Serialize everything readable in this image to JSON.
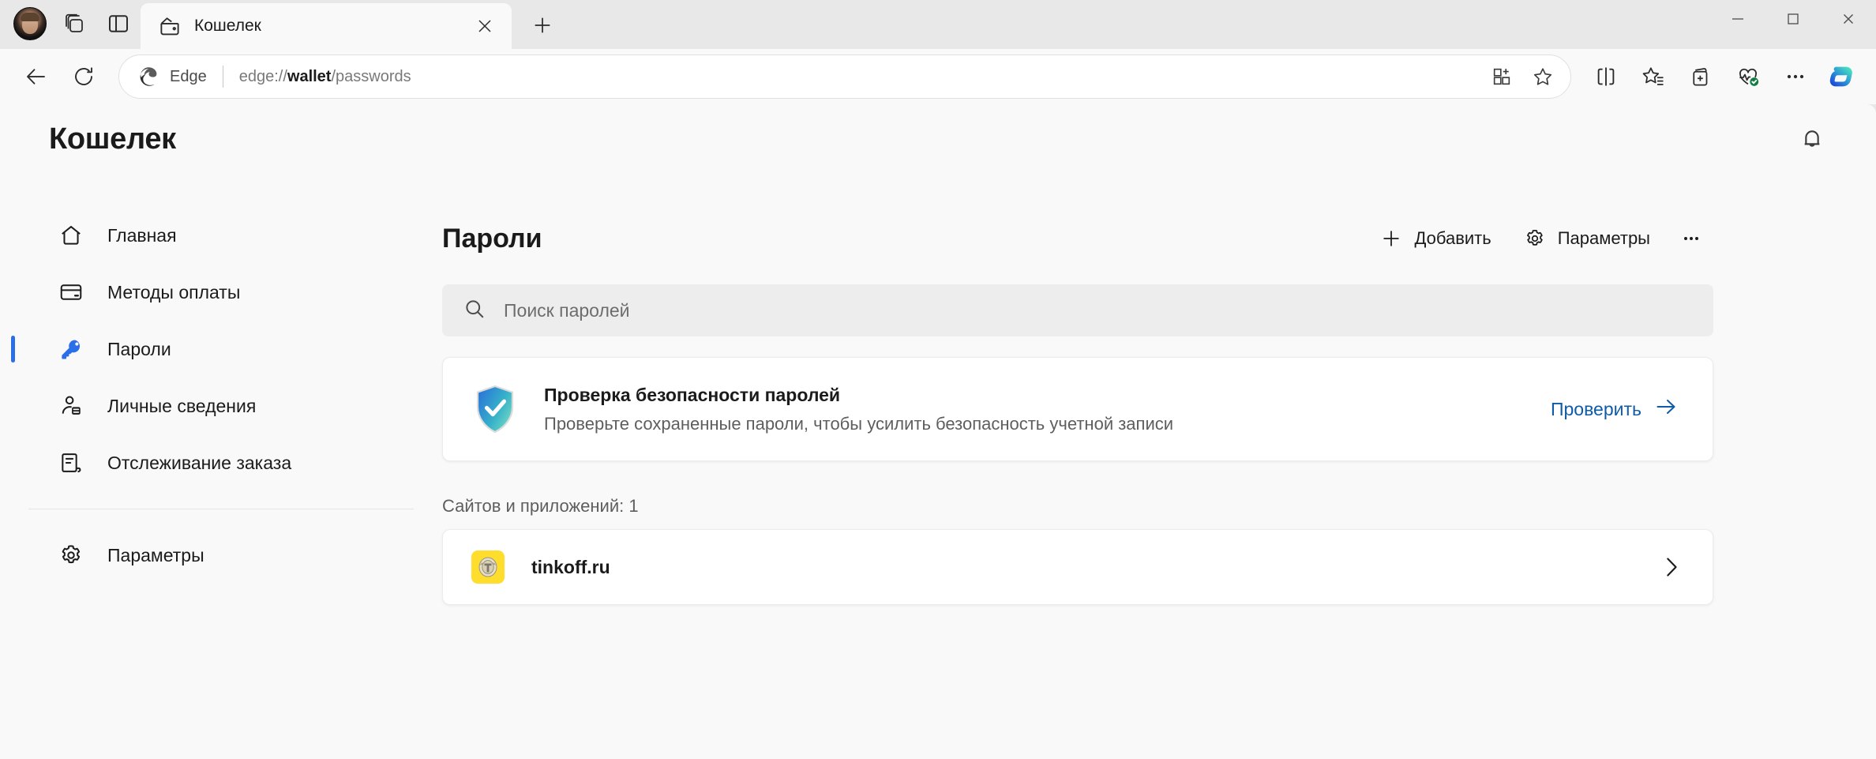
{
  "browser": {
    "tab": {
      "title": "Кошелек",
      "icon": "wallet-icon"
    },
    "new_tab_tooltip": "Новая вкладка",
    "omnibox": {
      "brand_label": "Edge",
      "url_prefix": "edge://",
      "url_bold": "wallet",
      "url_suffix": "/passwords",
      "url_full": "edge://wallet/passwords"
    },
    "window_controls": {
      "minimize": "—",
      "maximize": "□",
      "close": "✕"
    }
  },
  "header": {
    "title": "Кошелек",
    "notifications_label": "Уведомления"
  },
  "sidebar": {
    "items": [
      {
        "label": "Главная",
        "icon": "home-icon",
        "active": false
      },
      {
        "label": "Методы оплаты",
        "icon": "card-icon",
        "active": false
      },
      {
        "label": "Пароли",
        "icon": "key-icon",
        "active": true
      },
      {
        "label": "Личные сведения",
        "icon": "person-info-icon",
        "active": false
      },
      {
        "label": "Отслеживание заказа",
        "icon": "receipt-icon",
        "active": false
      }
    ],
    "footer_items": [
      {
        "label": "Параметры",
        "icon": "gear-icon",
        "active": false
      }
    ]
  },
  "main": {
    "title": "Пароли",
    "actions": {
      "add_label": "Добавить",
      "settings_label": "Параметры",
      "more_label": "Дополнительно"
    },
    "search": {
      "placeholder": "Поиск паролей",
      "value": ""
    },
    "health_card": {
      "title": "Проверка безопасности паролей",
      "subtitle": "Проверьте сохраненные пароли, чтобы усилить безопасность учетной записи",
      "action_label": "Проверить",
      "icon": "shield-check-icon"
    },
    "list_label": "Сайтов и приложений: 1",
    "sites": [
      {
        "name": "tinkoff.ru",
        "favicon": "tinkoff-favicon",
        "favicon_color": "#FFDD2D"
      }
    ]
  },
  "colors": {
    "accent": "#2B6FE8",
    "link": "#0F5BA7",
    "page_bg": "#F9F9F9",
    "chrome_bg": "#E8E8E8",
    "favicon_yellow": "#FFDD2D"
  }
}
